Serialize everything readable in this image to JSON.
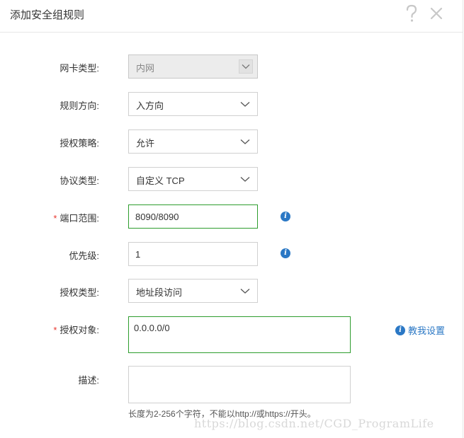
{
  "dialog": {
    "title": "添加安全组规则",
    "help_glyph": "?",
    "close_glyph": "✕"
  },
  "form": {
    "nic_type": {
      "label": "网卡类型:",
      "value": "内网"
    },
    "direction": {
      "label": "规则方向:",
      "value": "入方向"
    },
    "policy": {
      "label": "授权策略:",
      "value": "允许"
    },
    "protocol": {
      "label": "协议类型:",
      "value": "自定义 TCP"
    },
    "port_range": {
      "label": "端口范围:",
      "value": "8090/8090",
      "required": "*"
    },
    "priority": {
      "label": "优先级:",
      "value": "1"
    },
    "auth_type": {
      "label": "授权类型:",
      "value": "地址段访问"
    },
    "auth_object": {
      "label": "授权对象:",
      "value": "0.0.0.0/0",
      "required": "*",
      "help_link": "教我设置"
    },
    "description": {
      "label": "描述:",
      "value": "",
      "hint": "长度为2-256个字符，不能以http://或https://开头。"
    }
  },
  "icons": {
    "info_glyph": "i"
  },
  "watermark": "https://blog.csdn.net/CGD_ProgramLife",
  "colors": {
    "required": "#e8352d",
    "valid_border": "#2e9d2e",
    "link": "#2b78c5"
  }
}
